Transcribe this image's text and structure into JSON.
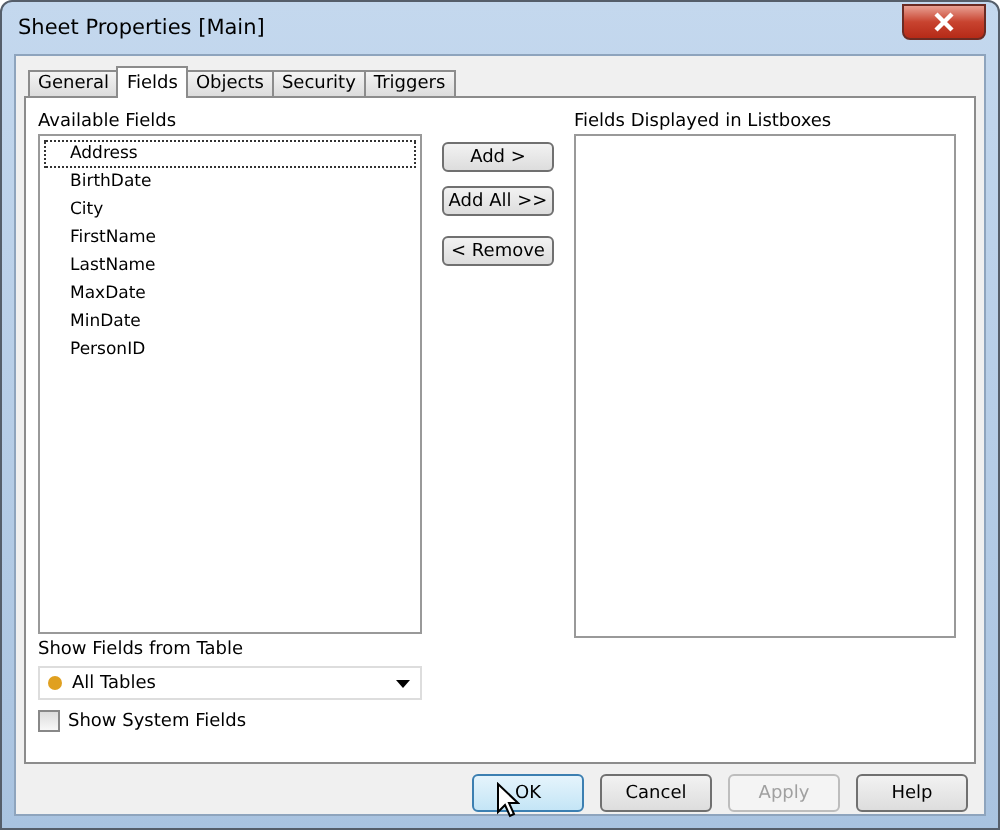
{
  "window": {
    "title": "Sheet Properties [Main]"
  },
  "tabs": [
    {
      "label": "General",
      "selected": false
    },
    {
      "label": "Fields",
      "selected": true
    },
    {
      "label": "Objects",
      "selected": false
    },
    {
      "label": "Security",
      "selected": false
    },
    {
      "label": "Triggers",
      "selected": false
    }
  ],
  "available_fields": {
    "label": "Available Fields",
    "items": [
      {
        "label": "Address",
        "selected": true
      },
      {
        "label": "BirthDate",
        "selected": false
      },
      {
        "label": "City",
        "selected": false
      },
      {
        "label": "FirstName",
        "selected": false
      },
      {
        "label": "LastName",
        "selected": false
      },
      {
        "label": "MaxDate",
        "selected": false
      },
      {
        "label": "MinDate",
        "selected": false
      },
      {
        "label": "PersonID",
        "selected": false
      }
    ]
  },
  "move_buttons": [
    "Add >",
    "Add All >>",
    "< Remove"
  ],
  "displayed_fields": {
    "label": "Fields Displayed in Listboxes"
  },
  "table_filter": {
    "label": "Show Fields from Table",
    "value": "All Tables",
    "color": "#e0a020"
  },
  "system_fields": {
    "label": "Show System Fields",
    "checked": false
  },
  "buttons": [
    {
      "label": "OK",
      "disabled": false,
      "default": true
    },
    {
      "label": "Cancel",
      "disabled": false,
      "default": false
    },
    {
      "label": "Apply",
      "disabled": true,
      "default": false
    },
    {
      "label": "Help",
      "disabled": false,
      "default": false
    }
  ]
}
